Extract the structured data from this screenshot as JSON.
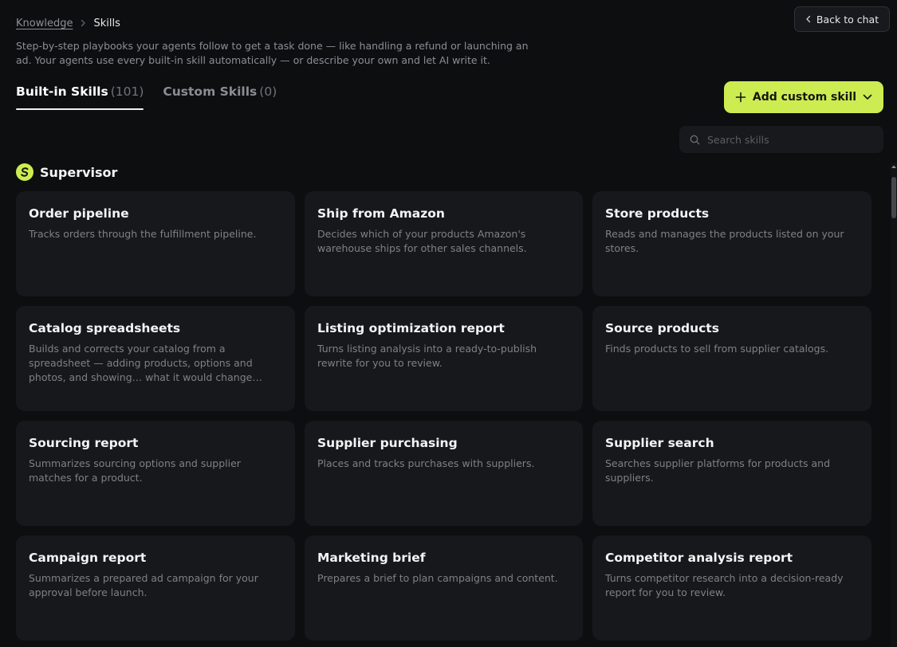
{
  "breadcrumb": {
    "parent": "Knowledge",
    "current": "Skills"
  },
  "header": {
    "back_label": "Back to chat",
    "description": "Step-by-step playbooks your agents follow to get a task done — like handling a refund or launching an ad. Your agents use every built-in skill automatically — or describe your own and let AI write it."
  },
  "tabs": [
    {
      "label": "Built-in Skills",
      "count": "(101)",
      "active": true
    },
    {
      "label": "Custom Skills",
      "count": "(0)",
      "active": false
    }
  ],
  "actions": {
    "add_label": "Add custom skill"
  },
  "search": {
    "placeholder": "Search skills",
    "value": ""
  },
  "section": {
    "title": "Supervisor"
  },
  "cards": [
    {
      "title": "Order pipeline",
      "description": "Tracks orders through the fulfillment pipeline."
    },
    {
      "title": "Ship from Amazon",
      "description": "Decides which of your products Amazon's warehouse ships for other sales channels."
    },
    {
      "title": "Store products",
      "description": "Reads and manages the products listed on your stores."
    },
    {
      "title": "Catalog spreadsheets",
      "description": "Builds and corrects your catalog from a spreadsheet — adding products, options and photos, and showing… what it would change before it changes anything."
    },
    {
      "title": "Listing optimization report",
      "description": "Turns listing analysis into a ready-to-publish rewrite for you to review."
    },
    {
      "title": "Source products",
      "description": "Finds products to sell from supplier catalogs."
    },
    {
      "title": "Sourcing report",
      "description": "Summarizes sourcing options and supplier matches for a product."
    },
    {
      "title": "Supplier purchasing",
      "description": "Places and tracks purchases with suppliers."
    },
    {
      "title": "Supplier search",
      "description": "Searches supplier platforms for products and suppliers."
    },
    {
      "title": "Campaign report",
      "description": "Summarizes a prepared ad campaign for your approval before launch."
    },
    {
      "title": "Marketing brief",
      "description": "Prepares a brief to plan campaigns and content."
    },
    {
      "title": "Competitor analysis report",
      "description": "Turns competitor research into a decision-ready report for you to review."
    }
  ],
  "colors": {
    "accent": "#cdec52",
    "background": "#0d0e10",
    "card": "#16181b"
  }
}
